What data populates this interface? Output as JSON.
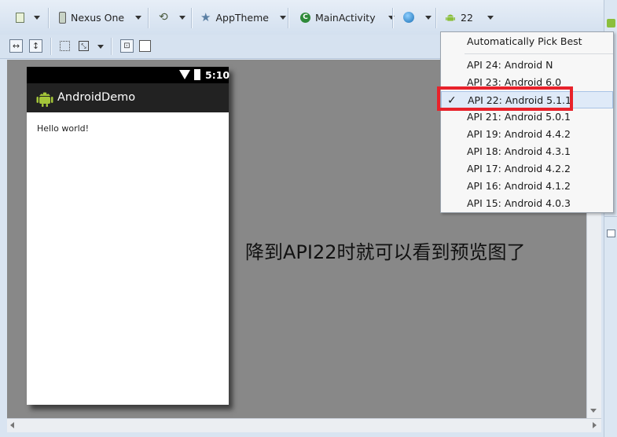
{
  "toolbar": {
    "device": "Nexus One",
    "theme": "AppTheme",
    "activity": "MainActivity",
    "api_level": "22"
  },
  "device_preview": {
    "status_time": "5:10",
    "app_title": "AndroidDemo",
    "content_text": "Hello world!"
  },
  "api_menu": {
    "auto_pick": "Automatically Pick Best",
    "items": [
      {
        "label": "API 24: Android N",
        "checked": false
      },
      {
        "label": "API 23: Android 6.0",
        "checked": false
      },
      {
        "label": "API 22: Android 5.1.1",
        "checked": true
      },
      {
        "label": "API 21: Android 5.0.1",
        "checked": false
      },
      {
        "label": "API 19: Android 4.4.2",
        "checked": false
      },
      {
        "label": "API 18: Android 4.3.1",
        "checked": false
      },
      {
        "label": "API 17: Android 4.2.2",
        "checked": false
      },
      {
        "label": "API 16: Android 4.1.2",
        "checked": false
      },
      {
        "label": "API 15: Android 4.0.3",
        "checked": false
      }
    ],
    "check_mark": "✓"
  },
  "annotation": "降到API22时就可以看到预览图了",
  "colors": {
    "highlight": "#e8222b",
    "canvas": "#888888",
    "menu_selected": "#dfeaf8"
  }
}
